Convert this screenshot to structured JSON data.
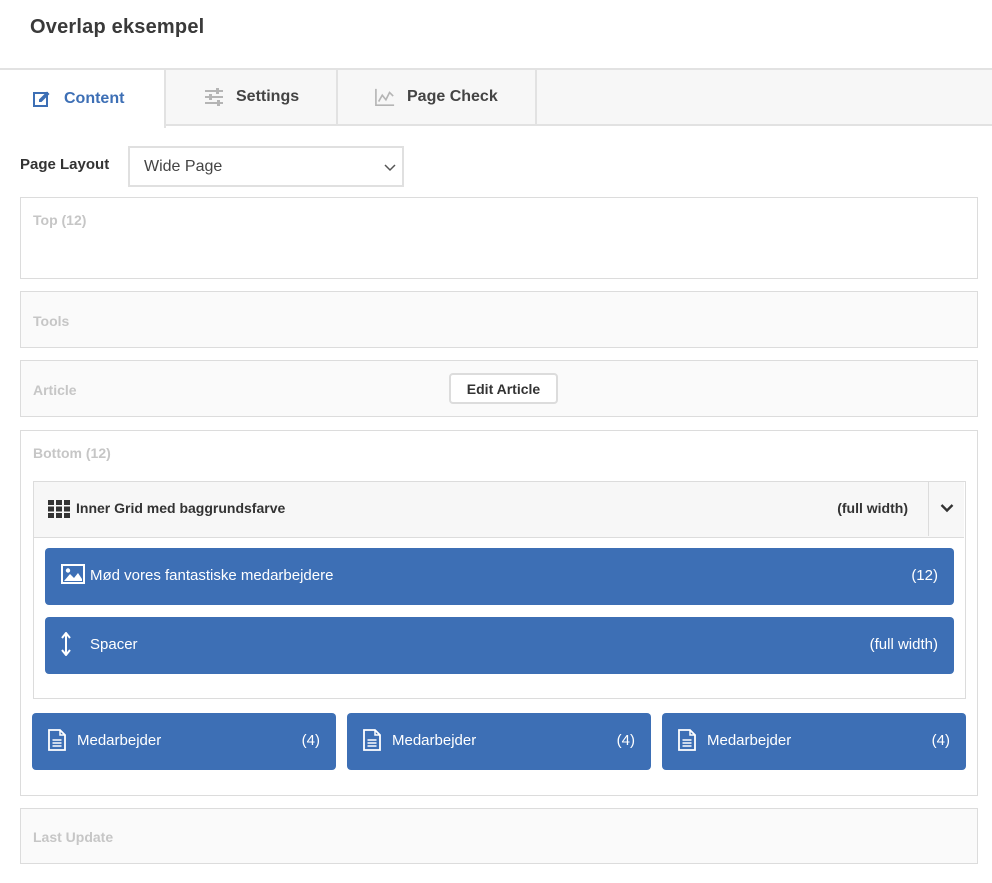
{
  "page": {
    "title": "Overlap eksempel"
  },
  "tabs": [
    {
      "label": "Content",
      "icon": "edit-icon",
      "active": true
    },
    {
      "label": "Settings",
      "icon": "sliders-icon",
      "active": false
    },
    {
      "label": "Page Check",
      "icon": "chart-icon",
      "active": false
    }
  ],
  "layout": {
    "label": "Page Layout",
    "selected": "Wide Page"
  },
  "regions": {
    "top": {
      "label": "Top (12)"
    },
    "tools": {
      "label": "Tools"
    },
    "article": {
      "label": "Article",
      "edit_button": "Edit Article"
    },
    "bottom": {
      "label": "Bottom (12)"
    },
    "last_update": {
      "label": "Last Update"
    }
  },
  "inner_grid": {
    "title": "Inner Grid med baggrundsfarve",
    "width": "(full width)",
    "icon": "grid-icon",
    "blocks": [
      {
        "label": "Mød vores fantastiske medarbejdere",
        "width": "(12)",
        "icon": "image-icon"
      },
      {
        "label": "Spacer",
        "width": "(full width)",
        "icon": "vertical-resize-icon"
      }
    ]
  },
  "cards": [
    {
      "label": "Medarbejder",
      "width": "(4)",
      "icon": "document-icon"
    },
    {
      "label": "Medarbejder",
      "width": "(4)",
      "icon": "document-icon"
    },
    {
      "label": "Medarbejder",
      "width": "(4)",
      "icon": "document-icon"
    }
  ],
  "colors": {
    "accent": "#3d6fb5",
    "border": "#dcdcdc",
    "muted_label": "#c6c6c6"
  }
}
